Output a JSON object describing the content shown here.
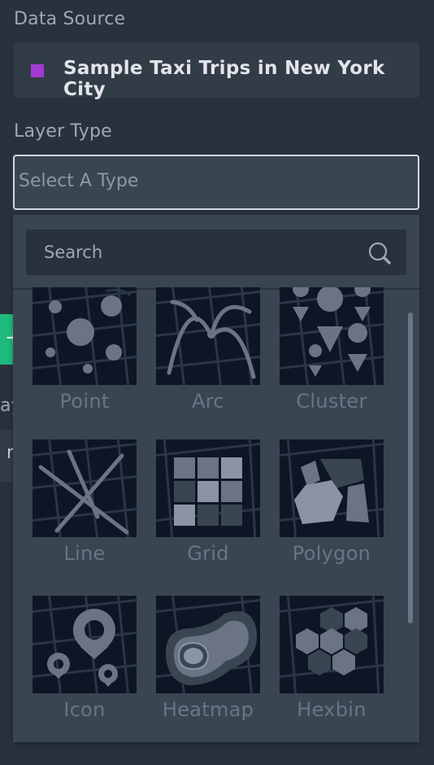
{
  "data_source": {
    "label": "Data Source",
    "name": "Sample Taxi Trips in New York City",
    "color": "#a33ad6"
  },
  "layer_type": {
    "label": "Layer Type",
    "placeholder": "Select A Type"
  },
  "background": {
    "button_text": "+",
    "partial_text_1": "ay",
    "partial_text_2": "r"
  },
  "search": {
    "placeholder": "Search",
    "icon": "search-icon"
  },
  "layers": [
    {
      "label": "Point",
      "icon": "point-icon"
    },
    {
      "label": "Arc",
      "icon": "arc-icon"
    },
    {
      "label": "Cluster",
      "icon": "cluster-icon"
    },
    {
      "label": "Line",
      "icon": "line-icon"
    },
    {
      "label": "Grid",
      "icon": "grid-icon"
    },
    {
      "label": "Polygon",
      "icon": "polygon-icon"
    },
    {
      "label": "Icon",
      "icon": "icon-layer-icon"
    },
    {
      "label": "Heatmap",
      "icon": "heatmap-icon"
    },
    {
      "label": "Hexbin",
      "icon": "hexbin-icon"
    }
  ],
  "colors": {
    "panel_bg": "#29323c",
    "input_bg": "#3a4552",
    "tile_bg": "#0e1625",
    "icon_fill": "#6a7485"
  }
}
